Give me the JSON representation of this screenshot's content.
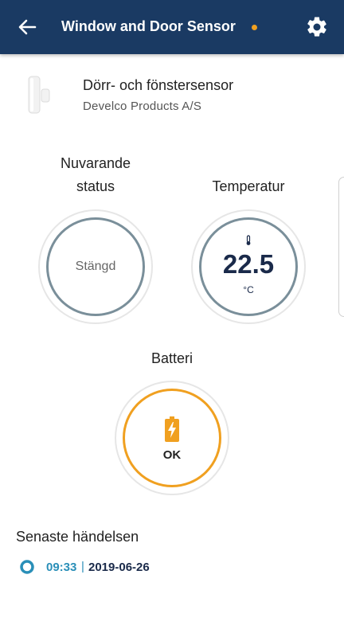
{
  "appbar": {
    "title": "Window and Door Sensor",
    "back_icon": "arrow-left-icon",
    "settings_icon": "gear-icon",
    "status_dot_color": "#f0a020",
    "background": "#1a3a63"
  },
  "device": {
    "name": "Dörr- och fönstersensor",
    "vendor": "Develco Products A/S",
    "image_icon": "door-sensor-icon"
  },
  "status": {
    "label_line1": "Nuvarande",
    "label_line2": "status",
    "value": "Stängd"
  },
  "temperature": {
    "label": "Temperatur",
    "icon": "thermometer-icon",
    "value": "22.5",
    "unit": "°C"
  },
  "battery": {
    "label": "Batteri",
    "icon": "battery-charging-icon",
    "value": "OK",
    "color": "#f0a020"
  },
  "events": {
    "title": "Senaste händelsen",
    "latest": {
      "time": "09:33",
      "separator": "|",
      "date": "2019-06-26"
    }
  }
}
